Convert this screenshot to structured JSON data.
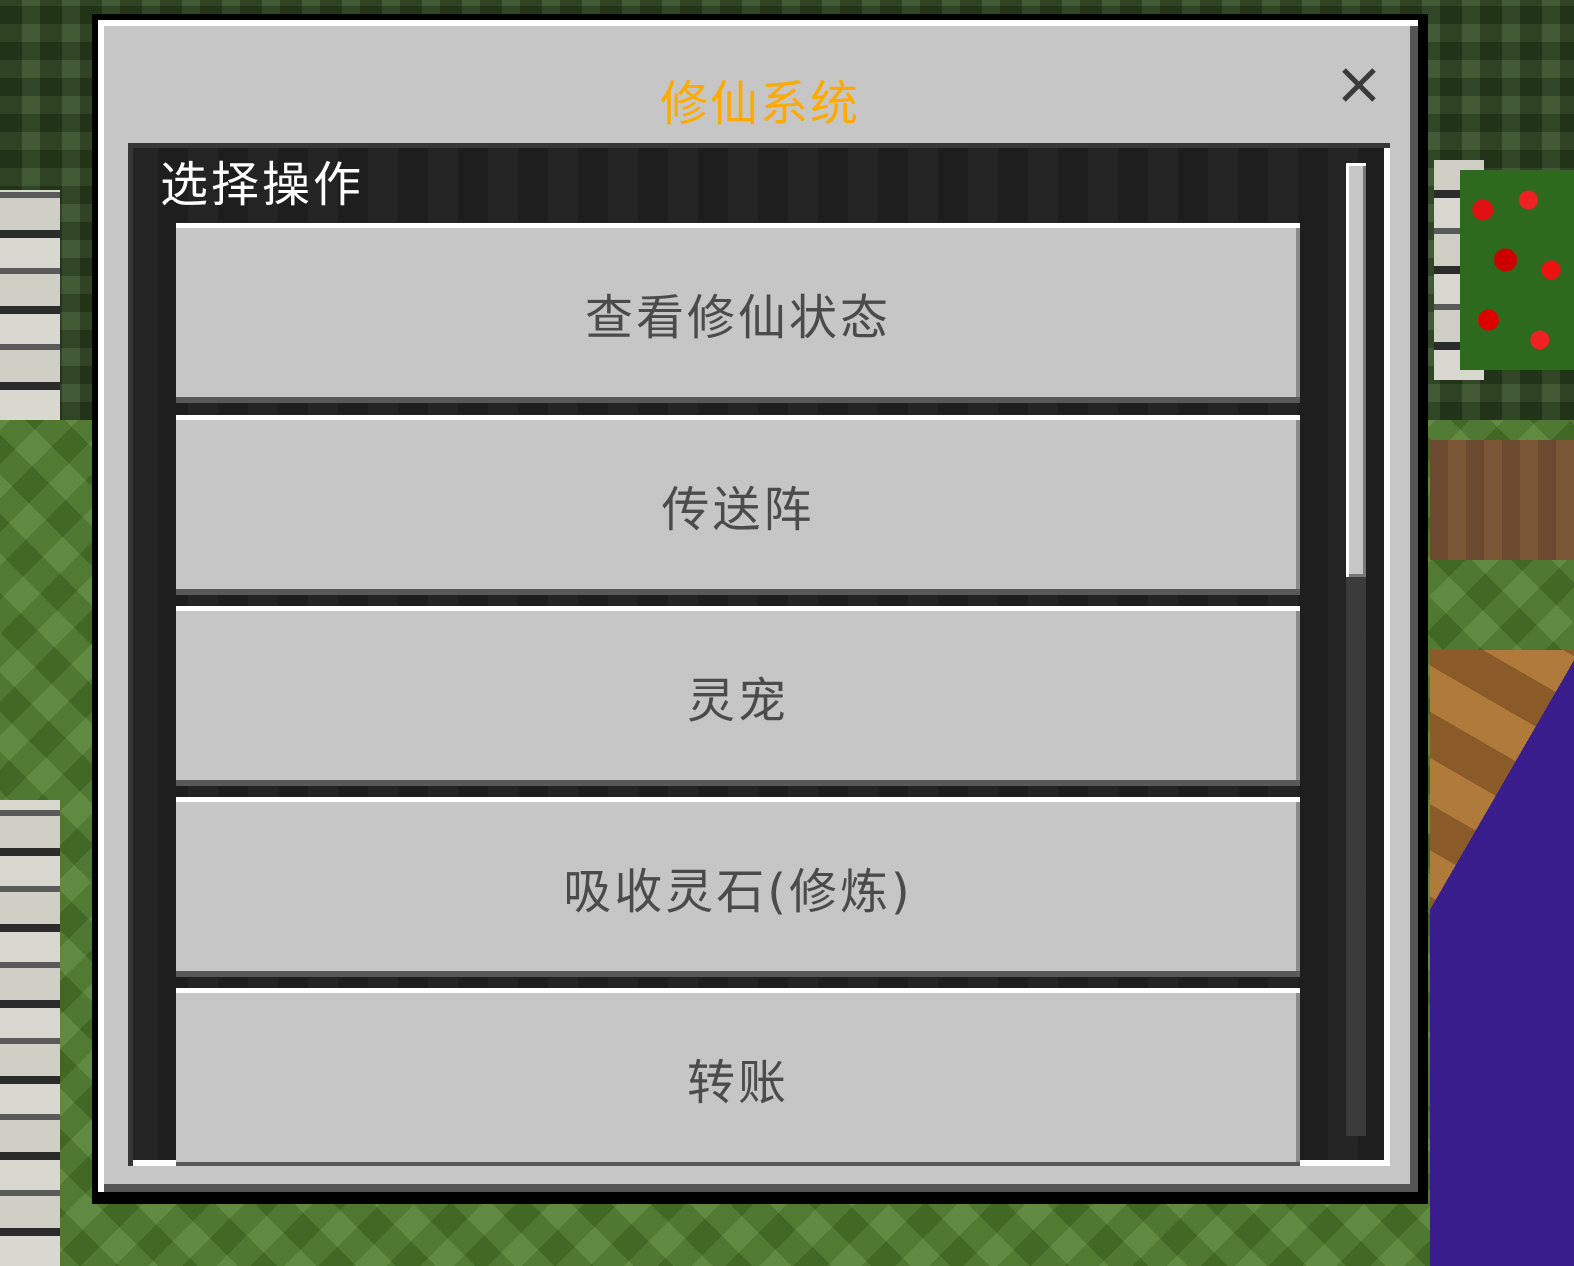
{
  "dialog": {
    "title": "修仙系统",
    "title_color": "#ffaa00",
    "close_icon": "close-icon"
  },
  "panel": {
    "label": "选择操作",
    "options": [
      {
        "label": "查看修仙状态"
      },
      {
        "label": "传送阵"
      },
      {
        "label": "灵宠"
      },
      {
        "label": "吸收灵石(修炼)"
      },
      {
        "label": "转账"
      }
    ],
    "scroll_position": 0
  }
}
